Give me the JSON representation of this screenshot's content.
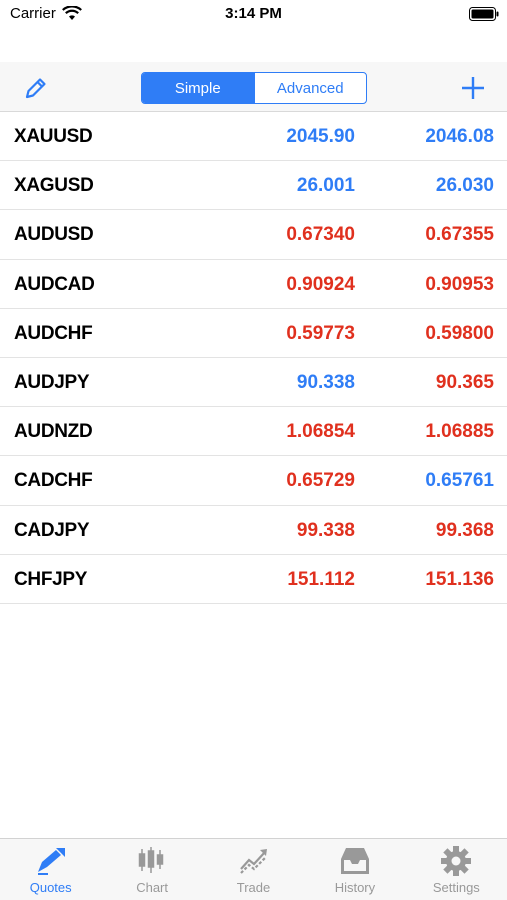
{
  "status": {
    "carrier": "Carrier",
    "time": "3:14 PM"
  },
  "toolbar": {
    "simple_label": "Simple",
    "advanced_label": "Advanced",
    "active_mode": "Simple"
  },
  "colors": {
    "accent": "#2f7df6",
    "up": "#2f7df6",
    "down": "#e0301e",
    "tab_inactive": "#999999"
  },
  "quotes": [
    {
      "symbol": "XAUUSD",
      "bid": "2045.90",
      "ask": "2046.08",
      "bid_color": "#2f7df6",
      "ask_color": "#2f7df6"
    },
    {
      "symbol": "XAGUSD",
      "bid": "26.001",
      "ask": "26.030",
      "bid_color": "#2f7df6",
      "ask_color": "#2f7df6"
    },
    {
      "symbol": "AUDUSD",
      "bid": "0.67340",
      "ask": "0.67355",
      "bid_color": "#e0301e",
      "ask_color": "#e0301e"
    },
    {
      "symbol": "AUDCAD",
      "bid": "0.90924",
      "ask": "0.90953",
      "bid_color": "#e0301e",
      "ask_color": "#e0301e"
    },
    {
      "symbol": "AUDCHF",
      "bid": "0.59773",
      "ask": "0.59800",
      "bid_color": "#e0301e",
      "ask_color": "#e0301e"
    },
    {
      "symbol": "AUDJPY",
      "bid": "90.338",
      "ask": "90.365",
      "bid_color": "#2f7df6",
      "ask_color": "#e0301e"
    },
    {
      "symbol": "AUDNZD",
      "bid": "1.06854",
      "ask": "1.06885",
      "bid_color": "#e0301e",
      "ask_color": "#e0301e"
    },
    {
      "symbol": "CADCHF",
      "bid": "0.65729",
      "ask": "0.65761",
      "bid_color": "#e0301e",
      "ask_color": "#2f7df6"
    },
    {
      "symbol": "CADJPY",
      "bid": "99.338",
      "ask": "99.368",
      "bid_color": "#e0301e",
      "ask_color": "#e0301e"
    },
    {
      "symbol": "CHFJPY",
      "bid": "151.112",
      "ask": "151.136",
      "bid_color": "#e0301e",
      "ask_color": "#e0301e"
    }
  ],
  "tabs": [
    {
      "label": "Quotes",
      "icon": "quotes-icon",
      "active": true
    },
    {
      "label": "Chart",
      "icon": "chart-icon",
      "active": false
    },
    {
      "label": "Trade",
      "icon": "trade-icon",
      "active": false
    },
    {
      "label": "History",
      "icon": "history-icon",
      "active": false
    },
    {
      "label": "Settings",
      "icon": "settings-icon",
      "active": false
    }
  ]
}
